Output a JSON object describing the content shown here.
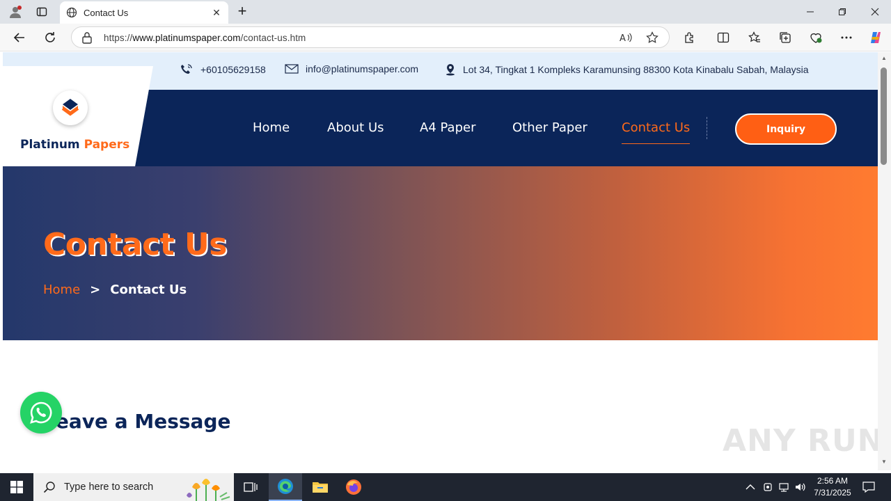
{
  "browser": {
    "tab_title": "Contact Us",
    "url_prefix": "https://",
    "url_host": "www.platinumspaper.com",
    "url_path": "/contact-us.htm"
  },
  "topbar": {
    "phone": "+60105629158",
    "email": "info@platinumspaper.com",
    "address": "Lot 34, Tingkat 1 Kompleks Karamunsing 88300 Kota Kinabalu Sabah, Malaysia"
  },
  "logo": {
    "word1": "Platinum",
    "word2": "Papers"
  },
  "nav": {
    "items": [
      {
        "label": "Home"
      },
      {
        "label": "About Us"
      },
      {
        "label": "A4 Paper"
      },
      {
        "label": "Other Paper"
      },
      {
        "label": "Contact Us"
      }
    ],
    "active": "Contact Us",
    "inquiry_label": "Inquiry"
  },
  "hero": {
    "title": "Contact Us",
    "breadcrumb_home": "Home",
    "breadcrumb_sep": ">",
    "breadcrumb_current": "Contact Us"
  },
  "section": {
    "heading": "Leave a Message"
  },
  "watermark": "ANY RUN",
  "taskbar": {
    "search_placeholder": "Type here to search",
    "time": "2:56 AM",
    "date": "7/31/2025"
  },
  "colors": {
    "navy": "#0b2559",
    "orange": "#ff6a1a",
    "topbar_bg": "#e3effb",
    "whatsapp": "#25d366"
  }
}
